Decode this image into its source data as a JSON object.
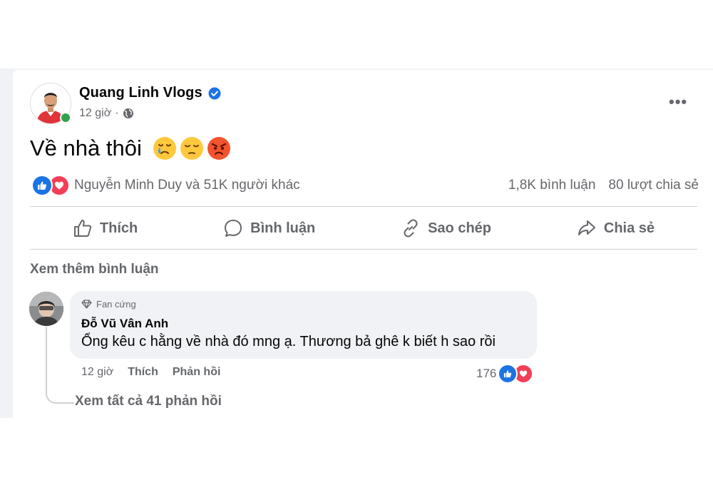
{
  "post": {
    "author": "Quang Linh Vlogs",
    "time": "12 giờ",
    "separator": "·",
    "text": "Về nhà thôi",
    "emojis": [
      "crying-face",
      "pensive-face",
      "angry-face"
    ],
    "reactions_text": "Nguyễn Minh Duy và 51K người khác",
    "comments_count": "1,8K bình luận",
    "shares_count": "80 lượt chia sẻ"
  },
  "actions": {
    "like": "Thích",
    "comment": "Bình luận",
    "copy": "Sao chép",
    "share": "Chia sẻ"
  },
  "comments": {
    "see_more": "Xem thêm bình luận",
    "top": {
      "badge": "Fan cứng",
      "name": "Đỗ Vũ Vân Anh",
      "text": "Ổng kêu c hằng về nhà đó mng ạ. Thương bả ghê k biết h sao rồi",
      "time": "12 giờ",
      "like": "Thích",
      "reply": "Phản hồi",
      "reaction_count": "176"
    },
    "view_replies": "Xem tất cả 41 phản hồi"
  },
  "colors": {
    "accent_blue": "#1b74e4",
    "love_red": "#f33e58",
    "online_green": "#31a24c",
    "muted_text": "#65676b"
  }
}
